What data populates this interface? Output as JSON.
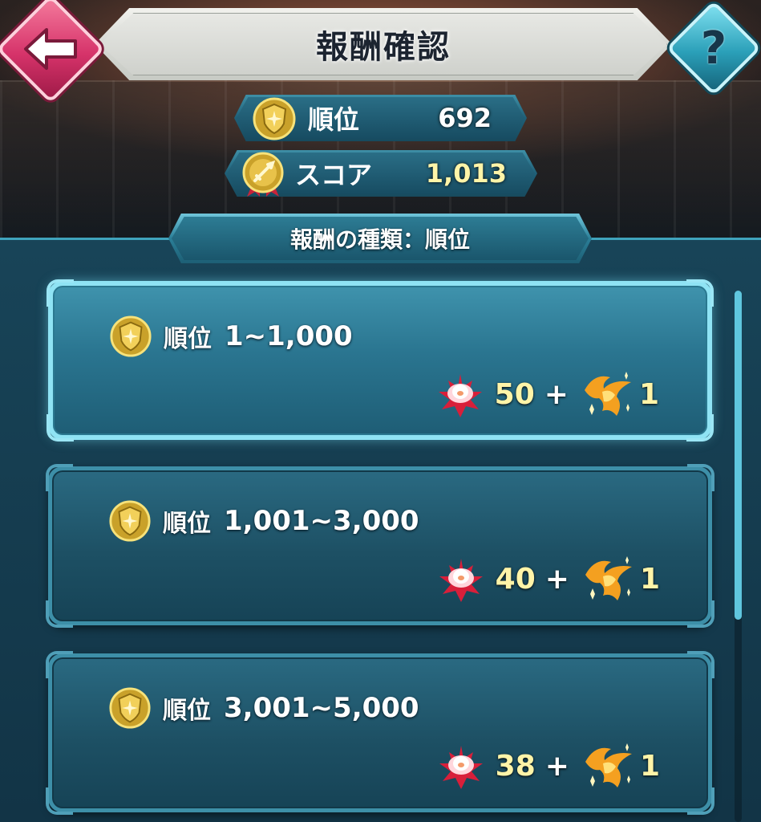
{
  "header": {
    "title": "報酬確認"
  },
  "stats": {
    "rank_label": "順位",
    "rank_value": "692",
    "score_label": "スコア",
    "score_value": "1,013"
  },
  "reward_type": {
    "label": "報酬の種類：順位"
  },
  "rewards": [
    {
      "rank_label": "順位",
      "range": "1~1,000",
      "amount": "50",
      "plus": "+",
      "count": "1"
    },
    {
      "rank_label": "順位",
      "range": "1,001~3,000",
      "amount": "40",
      "plus": "+",
      "count": "1"
    },
    {
      "rank_label": "順位",
      "range": "3,001~5,000",
      "amount": "38",
      "plus": "+",
      "count": "1"
    }
  ],
  "icons": {
    "back": "back-arrow-icon",
    "help": "question-mark-icon",
    "rank": "gold-shield-medal-icon",
    "score": "sword-medal-icon",
    "reward_primary": "red-lotus-flower-icon",
    "reward_secondary": "golden-phoenix-icon"
  },
  "colors": {
    "accent": "#8fe3f4",
    "gold_text": "#fff4a8",
    "back_button": "#d6336a",
    "help_button": "#2a9fb8"
  }
}
